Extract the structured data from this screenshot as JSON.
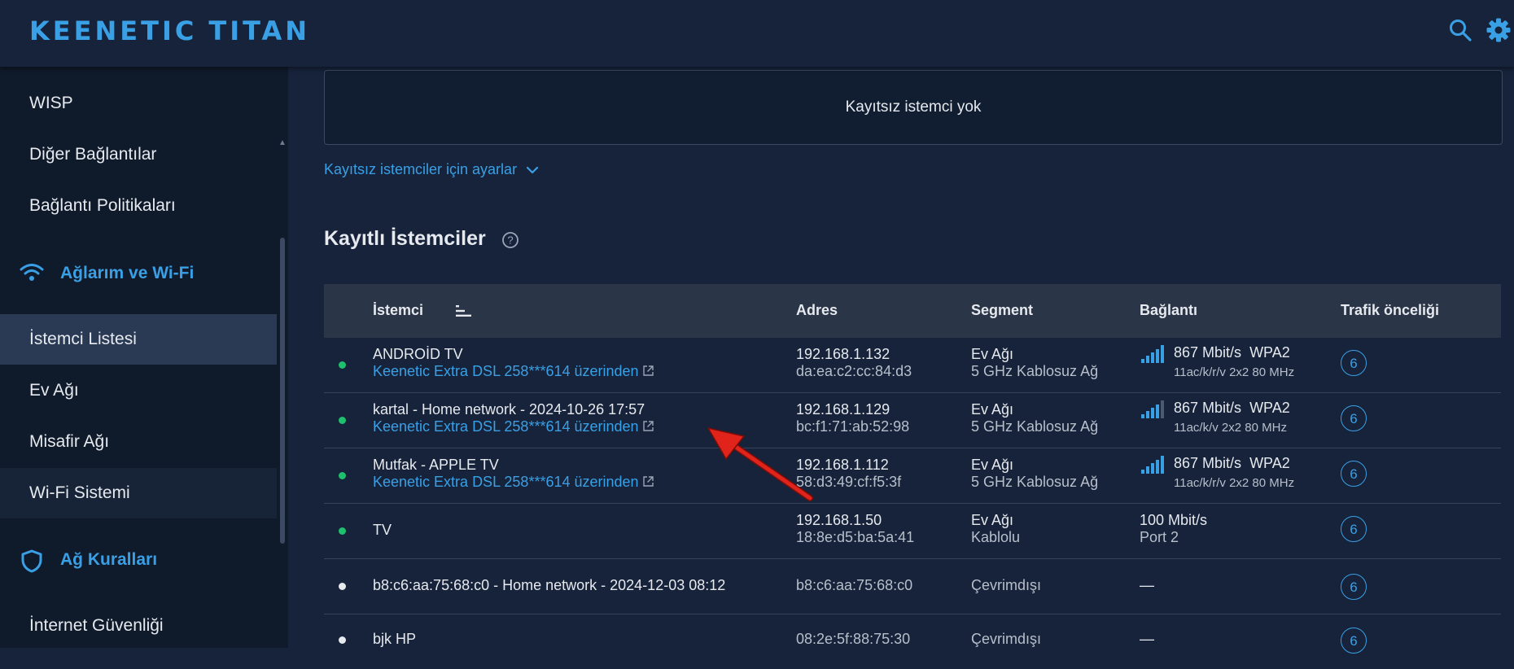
{
  "header": {
    "logo_part1": "KEENETIC",
    "logo_part2": "TITAN",
    "search_icon": "search-icon",
    "settings_icon": "gear-icon"
  },
  "sidebar": {
    "items": [
      {
        "label": "WISP"
      },
      {
        "label": "Diğer Bağlantılar"
      },
      {
        "label": "Bağlantı Politikaları"
      },
      {
        "label": "İstemci Listesi"
      },
      {
        "label": "Ev Ağı"
      },
      {
        "label": "Misafir Ağı"
      },
      {
        "label": "Wi-Fi Sistemi"
      },
      {
        "label": "İnternet Güvenliği"
      }
    ],
    "sections": [
      {
        "label": "Ağlarım ve Wi-Fi",
        "icon": "wifi-icon"
      },
      {
        "label": "Ağ Kuralları",
        "icon": "shield-icon"
      }
    ]
  },
  "unregistered": {
    "empty_text": "Kayıtsız istemci yok",
    "settings_link": "Kayıtsız istemciler için ayarlar"
  },
  "registered": {
    "title": "Kayıtlı İstemciler",
    "columns": {
      "client": "İstemci",
      "address": "Adres",
      "segment": "Segment",
      "connection": "Bağlantı",
      "priority": "Trafik önceliği"
    },
    "rows": [
      {
        "status": "online",
        "name": "ANDROİD TV",
        "via": "Keenetic Extra DSL 258***614 üzerinden",
        "ip": "192.168.1.132",
        "mac": "da:ea:c2:cc:84:d3",
        "segment": "Ev Ağı",
        "segment_type": "5 GHz Kablosuz Ağ",
        "speed": "867 Mbit/s",
        "security": "WPA2",
        "mode": "11ac/k/r/v 2x2 80 MHz",
        "priority": "6"
      },
      {
        "status": "online",
        "name": "kartal - Home network - 2024-10-26 17:57",
        "via": "Keenetic Extra DSL 258***614 üzerinden",
        "ip": "192.168.1.129",
        "mac": "bc:f1:71:ab:52:98",
        "segment": "Ev Ağı",
        "segment_type": "5 GHz Kablosuz Ağ",
        "speed": "867 Mbit/s",
        "security": "WPA2",
        "mode": "11ac/k/v 2x2 80 MHz",
        "priority": "6"
      },
      {
        "status": "online",
        "name": "Mutfak - APPLE TV",
        "via": "Keenetic Extra DSL 258***614 üzerinden",
        "ip": "192.168.1.112",
        "mac": "58:d3:49:cf:f5:3f",
        "segment": "Ev Ağı",
        "segment_type": "5 GHz Kablosuz Ağ",
        "speed": "867 Mbit/s",
        "security": "WPA2",
        "mode": "11ac/k/r/v 2x2 80 MHz",
        "priority": "6"
      },
      {
        "status": "online",
        "name": "TV",
        "ip": "192.168.1.50",
        "mac": "18:8e:d5:ba:5a:41",
        "segment": "Ev Ağı",
        "segment_type": "Kablolu",
        "speed": "100 Mbit/s",
        "port": "Port 2",
        "priority": "6"
      },
      {
        "status": "offline",
        "name": "b8:c6:aa:75:68:c0 - Home network - 2024-12-03 08:12",
        "mac": "b8:c6:aa:75:68:c0",
        "segment": "Çevrimdışı",
        "connection": "—",
        "priority": "6"
      },
      {
        "status": "offline",
        "name": "bjk HP",
        "mac": "08:2e:5f:88:75:30",
        "segment": "Çevrimdışı",
        "connection": "—",
        "priority": "6"
      }
    ]
  },
  "colors": {
    "accent": "#3aa0e6",
    "online": "#1fc06d",
    "annotation_arrow": "#e0241b"
  }
}
